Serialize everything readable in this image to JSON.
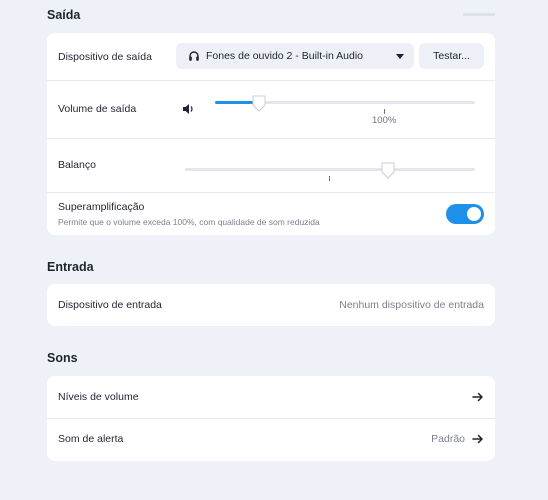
{
  "output": {
    "title": "Saída",
    "device": {
      "label": "Dispositivo de saída",
      "selected": "Fones de ouvido 2 - Built-in Audio",
      "icon": "headphones-icon",
      "test_button": "Testar..."
    },
    "volume": {
      "label": "Volume de saída",
      "icon": "speaker-icon",
      "value_fraction": 0.17,
      "mark_label": "100%"
    },
    "balance": {
      "label": "Balanço",
      "value_fraction": 0.7
    },
    "overamplification": {
      "label": "Superamplificação",
      "description": "Permite que o volume exceda 100%, com qualidade de som reduzida",
      "enabled": true
    }
  },
  "input": {
    "title": "Entrada",
    "device": {
      "label": "Dispositivo de entrada",
      "value": "Nenhum dispositivo de entrada"
    }
  },
  "sounds": {
    "title": "Sons",
    "items": [
      {
        "label": "Níveis de volume",
        "value": ""
      },
      {
        "label": "Som de alerta",
        "value": "Padrão"
      }
    ]
  },
  "colors": {
    "accent": "#1e90e8",
    "background": "#eef1f8",
    "card": "#ffffff"
  }
}
